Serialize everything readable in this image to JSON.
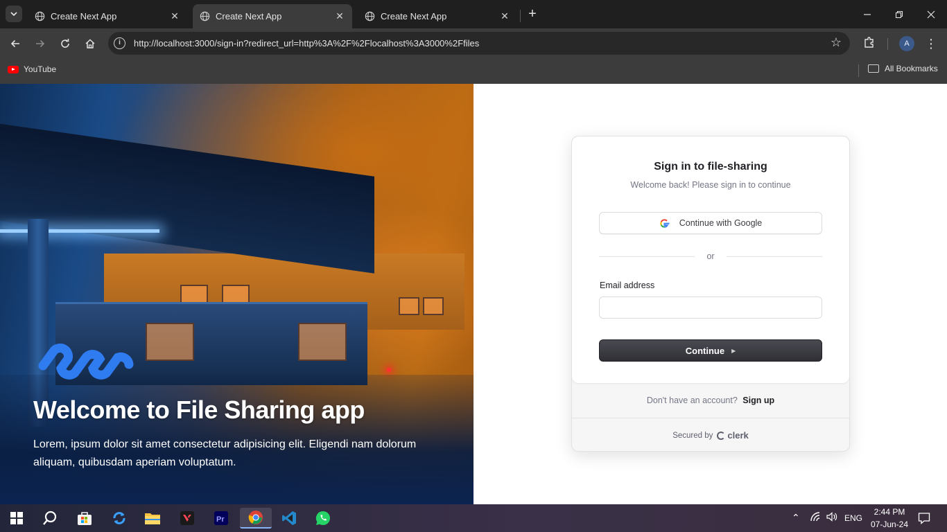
{
  "browser": {
    "tabs": [
      {
        "title": "Create Next App",
        "active": false
      },
      {
        "title": "Create Next App",
        "active": true
      },
      {
        "title": "Create Next App",
        "active": false
      }
    ],
    "url": "http://localhost:3000/sign-in?redirect_url=http%3A%2F%2Flocalhost%3A3000%2Ffiles",
    "profile_initial": "A",
    "bookmarks": [
      {
        "label": "YouTube",
        "icon": "youtube-icon"
      }
    ],
    "all_bookmarks_label": "All Bookmarks"
  },
  "hero": {
    "title": "Welcome to File Sharing app",
    "text": "Lorem, ipsum dolor sit amet consectetur adipisicing elit. Eligendi nam dolorum aliquam, quibusdam aperiam voluptatum.",
    "logo_color": "#2f7bf0"
  },
  "signin": {
    "title": "Sign in to file-sharing",
    "subtitle": "Welcome back! Please sign in to continue",
    "google_button": "Continue with Google",
    "divider": "or",
    "email_label": "Email address",
    "email_value": "",
    "continue_button": "Continue",
    "no_account_text": "Don't have an account?",
    "signup_link": "Sign up",
    "secured_by": "Secured by",
    "provider": "clerk"
  },
  "taskbar": {
    "apps": [
      "windows-start-icon",
      "search-icon",
      "microsoft-store-icon",
      "sync-icon",
      "file-explorer-icon",
      "valorant-icon",
      "premiere-pro-icon",
      "chrome-icon",
      "vscode-icon",
      "whatsapp-icon"
    ],
    "language": "ENG",
    "time": "2:44 PM",
    "date": "07-Jun-24"
  },
  "colors": {
    "accent_dark": "#2f2f35",
    "text_primary": "#212126",
    "text_muted": "#747686"
  }
}
